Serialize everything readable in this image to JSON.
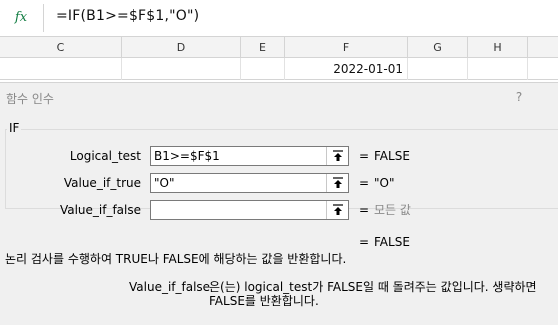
{
  "formula_bar": {
    "fx_icon": "fx",
    "formula": "=IF(B1>=$F$1,\"O\")"
  },
  "columns": [
    "C",
    "D",
    "E",
    "F",
    "G",
    "H"
  ],
  "grid": {
    "f1_value": "2022-01-01"
  },
  "dialog": {
    "title": "함수 인수",
    "help": "?",
    "function_name": "IF",
    "args": [
      {
        "label": "Logical_test",
        "value": "B1>=$F$1",
        "equals": "=",
        "result": "FALSE",
        "result_muted": false,
        "icon": "collapse-arrow-icon"
      },
      {
        "label": "Value_if_true",
        "value": "\"O\"",
        "equals": "=",
        "result": "\"O\"",
        "result_muted": false,
        "icon": "collapse-arrow-icon"
      },
      {
        "label": "Value_if_false",
        "value": "",
        "equals": "=",
        "result": "모든 값",
        "result_muted": true,
        "icon": "collapse-arrow-icon"
      }
    ],
    "summary_equals": "=",
    "summary_result": "FALSE",
    "description": "논리 검사를 수행하여 TRUE나 FALSE에 해당하는 값을 반환합니다.",
    "arg_help_name": "Value_if_false",
    "arg_help_line1": "은(는) logical_test가 FALSE일 때 돌려주는 값입니다. 생략하면",
    "arg_help_line2": "FALSE를 반환합니다."
  }
}
